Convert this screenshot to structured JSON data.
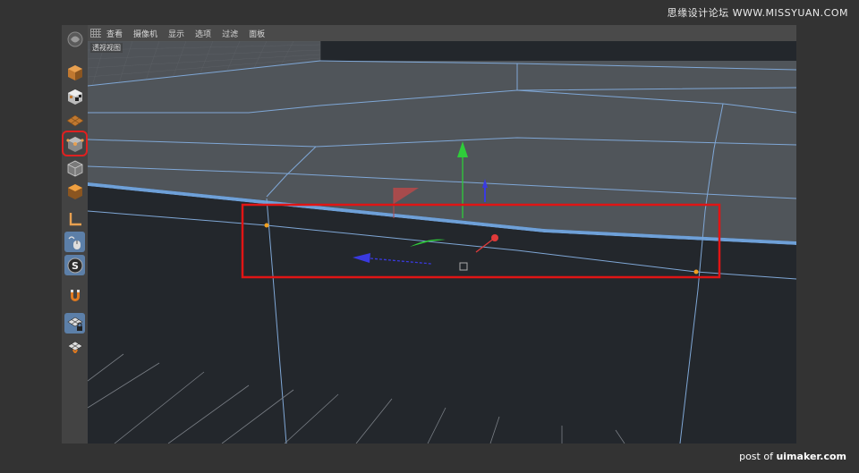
{
  "watermark": "思缘设计论坛 WWW.MISSYUAN.COM",
  "credit": {
    "prefix": "post of ",
    "site": "uimaker.com"
  },
  "menu": {
    "items": [
      "查看",
      "摄像机",
      "显示",
      "选项",
      "过滤",
      "面板"
    ]
  },
  "viewport": {
    "label": "透视视图"
  },
  "tools": [
    {
      "name": "model-mode-icon"
    },
    {
      "name": "texture-mode-icon"
    },
    {
      "name": "workplane-mode-icon"
    },
    {
      "name": "point-mode-icon",
      "active": true
    },
    {
      "name": "edge-mode-icon"
    },
    {
      "name": "polygon-mode-icon"
    },
    {
      "name": "axis-mode-icon"
    },
    {
      "name": "tweak-mode-icon"
    },
    {
      "name": "solo-mode-icon"
    },
    {
      "name": "snap-magnet-icon"
    },
    {
      "name": "locked-workplane-icon"
    },
    {
      "name": "planar-workplane-icon"
    }
  ],
  "colors": {
    "viewport_bg": "#23272c",
    "plane_fill": "#4f5459",
    "edge": "#7fa7d6",
    "highlight_edge": "#6ea0d8",
    "selection_box": "#e01515",
    "axis_x": "#e03a3a",
    "axis_y": "#2fcc3a",
    "axis_z": "#3a3ae0",
    "point": "#f0a020"
  }
}
